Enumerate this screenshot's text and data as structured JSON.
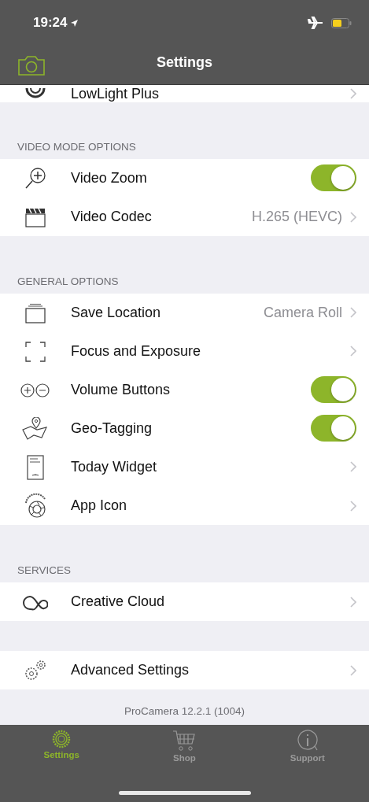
{
  "status_bar": {
    "time": "19:24"
  },
  "nav_bar": {
    "title": "Settings"
  },
  "sections": [
    {
      "rows": [
        {
          "kind": "link",
          "label": "LowLight Plus"
        }
      ]
    },
    {
      "header": "VIDEO MODE OPTIONS",
      "rows": [
        {
          "kind": "toggle",
          "label": "Video Zoom",
          "on": true
        },
        {
          "kind": "value",
          "label": "Video Codec",
          "value": "H.265 (HEVC)"
        }
      ]
    },
    {
      "header": "GENERAL OPTIONS",
      "rows": [
        {
          "kind": "value",
          "label": "Save Location",
          "value": "Camera Roll"
        },
        {
          "kind": "link",
          "label": "Focus and Exposure"
        },
        {
          "kind": "toggle",
          "label": "Volume Buttons",
          "on": true
        },
        {
          "kind": "toggle",
          "label": "Geo-Tagging",
          "on": true
        },
        {
          "kind": "link",
          "label": "Today Widget"
        },
        {
          "kind": "link",
          "label": "App Icon"
        }
      ]
    },
    {
      "header": "SERVICES",
      "rows": [
        {
          "kind": "link",
          "label": "Creative Cloud"
        }
      ]
    },
    {
      "rows": [
        {
          "kind": "link",
          "label": "Advanced Settings"
        }
      ]
    }
  ],
  "footer": "ProCamera 12.2.1 (1004)",
  "tab_bar": [
    {
      "label": "Settings",
      "selected": true
    },
    {
      "label": "Shop",
      "selected": false
    },
    {
      "label": "Support",
      "selected": false
    }
  ]
}
